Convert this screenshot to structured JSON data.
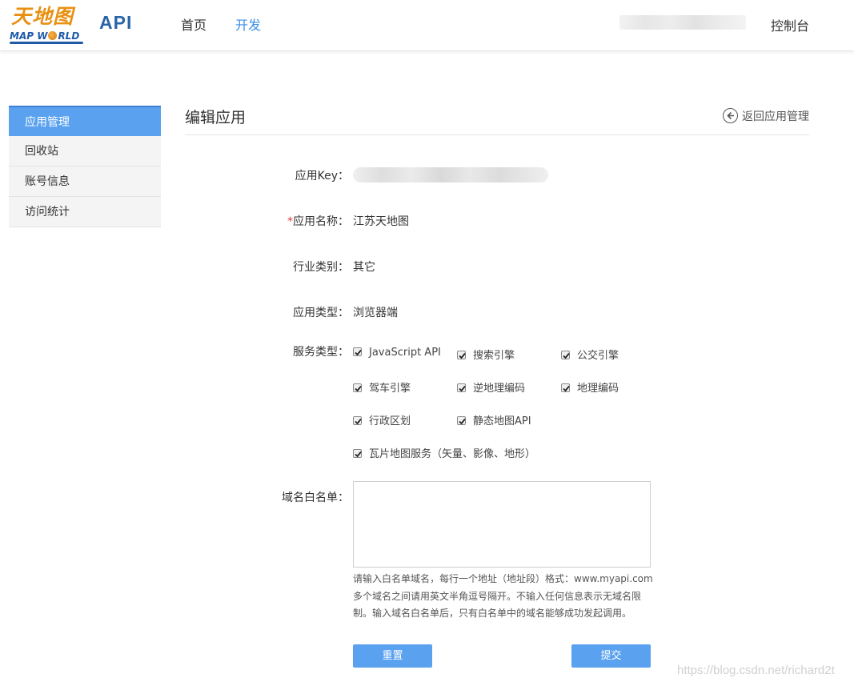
{
  "header": {
    "logo_cn": "天地图",
    "logo_en_part1": "MAP W",
    "logo_en_part2": "RLD",
    "api_label": "API",
    "nav": [
      "首页",
      "开发"
    ],
    "console": "控制台"
  },
  "sidebar": {
    "items": [
      {
        "label": "应用管理",
        "active": true
      },
      {
        "label": "回收站",
        "active": false
      },
      {
        "label": "账号信息",
        "active": false
      },
      {
        "label": "访问统计",
        "active": false
      }
    ]
  },
  "main": {
    "title": "编辑应用",
    "back_label": "返回应用管理",
    "fields": {
      "key_label": "应用Key：",
      "name_required_mark": "*",
      "name_label": "应用名称：",
      "name_value": "江苏天地图",
      "industry_label": "行业类别：",
      "industry_value": "其它",
      "app_type_label": "应用类型：",
      "app_type_value": "浏览器端",
      "service_label": "服务类型：",
      "whitelist_label": "域名白名单："
    },
    "services": [
      {
        "label": "JavaScript API",
        "checked": true
      },
      {
        "label": "搜索引擎",
        "checked": true
      },
      {
        "label": "公交引擎",
        "checked": true
      },
      {
        "label": "驾车引擎",
        "checked": true
      },
      {
        "label": "逆地理编码",
        "checked": true
      },
      {
        "label": "地理编码",
        "checked": true
      },
      {
        "label": "行政区划",
        "checked": true
      },
      {
        "label": "静态地图API",
        "checked": true
      },
      {
        "label": "瓦片地图服务（矢量、影像、地形）",
        "checked": true
      }
    ],
    "whitelist_value": "",
    "hint_lines": [
      "请输入白名单域名，每行一个地址（地址段）格式：www.myapi.com",
      "多个域名之间请用英文半角逗号隔开。不输入任何信息表示无域名限",
      "制。输入域名白名单后，只有白名单中的域名能够成功发起调用。"
    ],
    "reset_label": "重置",
    "submit_label": "提交"
  },
  "watermark": "https://blog.csdn.net/richard2t",
  "colors": {
    "accent": "#5aa1f0",
    "nav_active": "#3a8ee6",
    "logo_orange": "#e89012",
    "logo_blue": "#1f5aa8",
    "required": "#e03b3b"
  }
}
